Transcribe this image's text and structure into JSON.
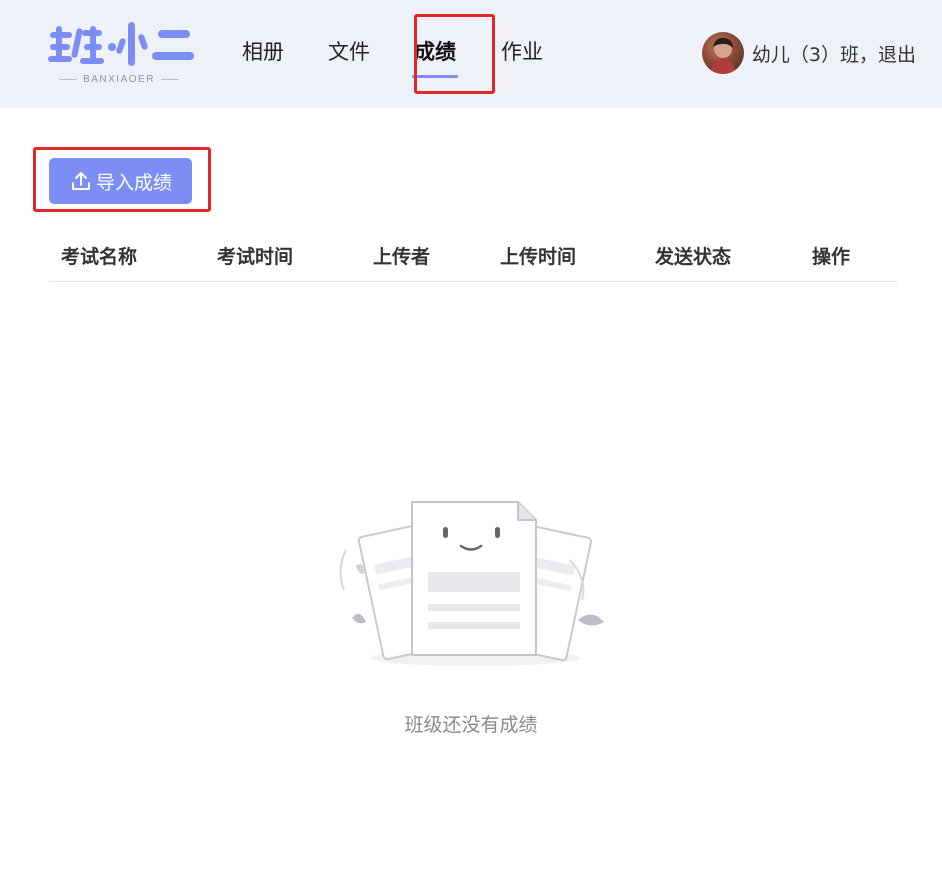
{
  "header": {
    "logo": {
      "text": "班·小二",
      "subtitle": "BANXIAOER"
    },
    "nav": [
      {
        "label": "相册",
        "active": false
      },
      {
        "label": "文件",
        "active": false
      },
      {
        "label": "成绩",
        "active": true
      },
      {
        "label": "作业",
        "active": false
      }
    ],
    "user": {
      "label": "幼儿（3）班，退出"
    }
  },
  "toolbar": {
    "import_label": "导入成绩",
    "import_icon": "upload-icon"
  },
  "table": {
    "columns": [
      "考试名称",
      "考试时间",
      "上传者",
      "上传时间",
      "发送状态",
      "操作"
    ],
    "rows": []
  },
  "empty_state": {
    "message": "班级还没有成绩",
    "icon": "empty-documents-illustration"
  },
  "colors": {
    "accent": "#7c8ef3",
    "highlight": "#e32626",
    "header_bg": "#eef2f8"
  }
}
